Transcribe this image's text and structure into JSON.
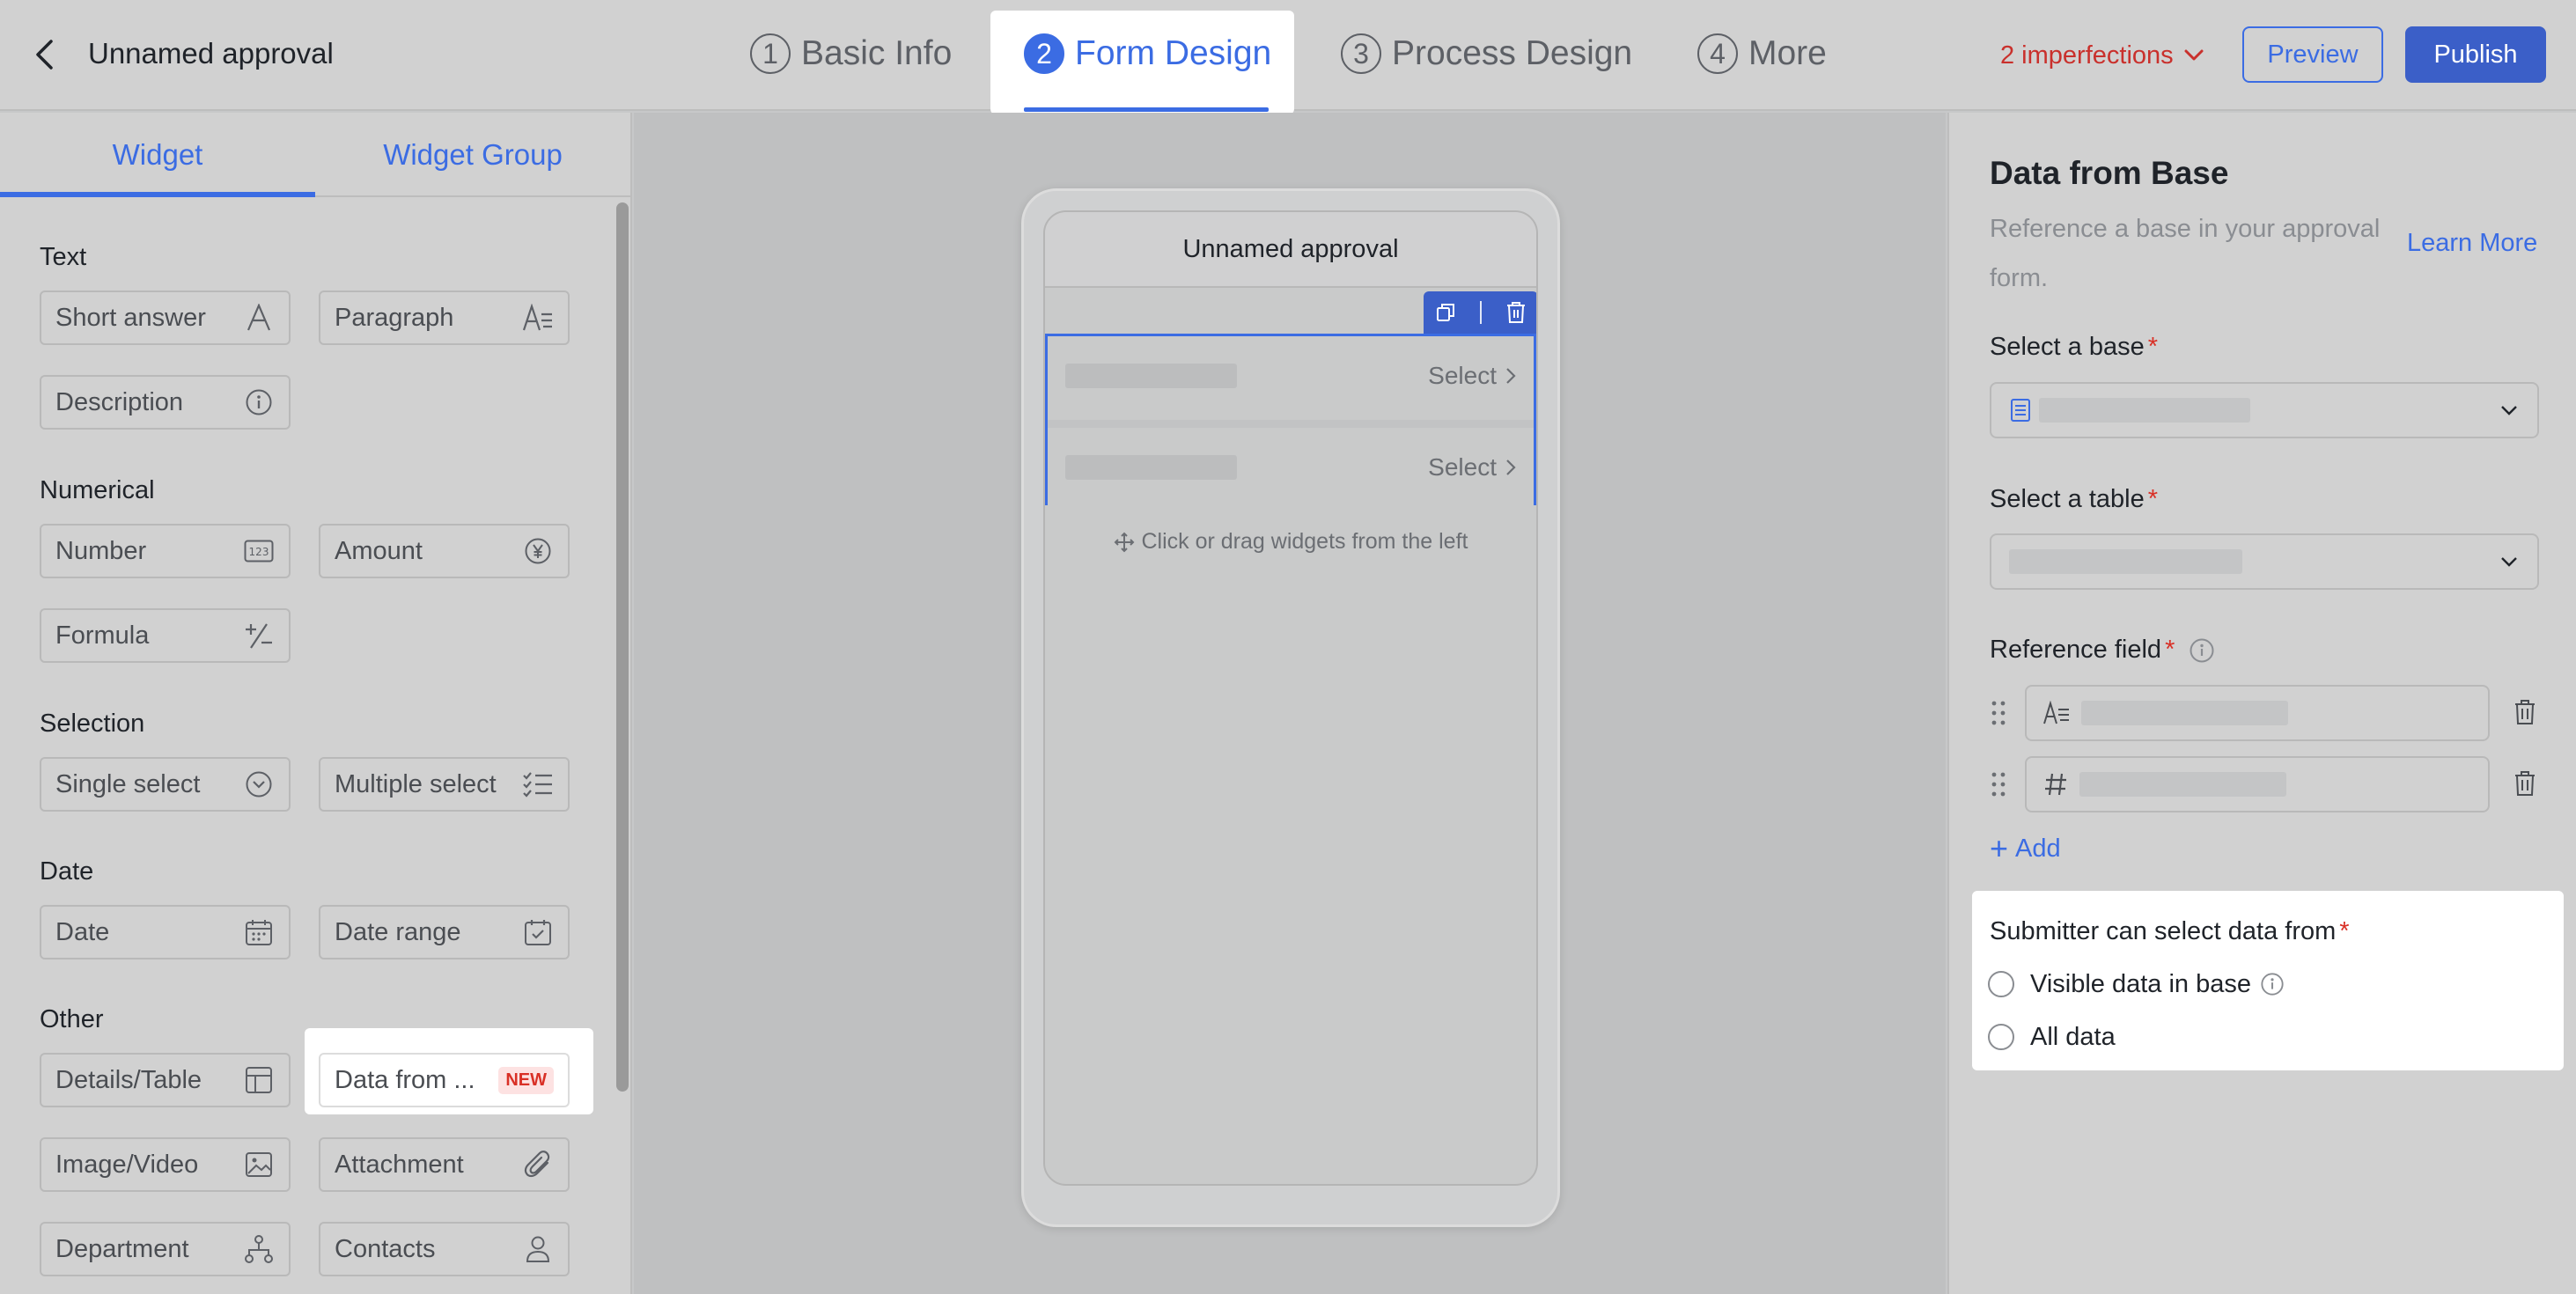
{
  "header": {
    "app_title": "Unnamed approval",
    "steps": [
      {
        "num": "1",
        "label": "Basic Info"
      },
      {
        "num": "2",
        "label": "Form Design"
      },
      {
        "num": "3",
        "label": "Process Design"
      },
      {
        "num": "4",
        "label": "More"
      }
    ],
    "active_step": "Form Design",
    "imperfections": "2 imperfections",
    "preview_label": "Preview",
    "publish_label": "Publish"
  },
  "left_panel": {
    "tabs": [
      "Widget",
      "Widget Group"
    ],
    "sections": {
      "text": "Text",
      "numerical": "Numerical",
      "selection": "Selection",
      "date": "Date",
      "other": "Other"
    },
    "widgets": {
      "short_answer": "Short answer",
      "paragraph": "Paragraph",
      "description": "Description",
      "number": "Number",
      "amount": "Amount",
      "formula": "Formula",
      "single_select": "Single select",
      "multiple_select": "Multiple select",
      "date": "Date",
      "date_range": "Date range",
      "details_table": "Details/Table",
      "data_from": "Data from ...",
      "image_video": "Image/Video",
      "attachment": "Attachment",
      "department": "Department",
      "contacts": "Contacts"
    },
    "new_badge": "NEW"
  },
  "canvas": {
    "phone_title": "Unnamed approval",
    "rows": [
      {
        "action": "Select"
      },
      {
        "action": "Select"
      }
    ],
    "drop_hint": "Click or drag widgets from the left"
  },
  "right_panel": {
    "title": "Data from Base",
    "description": "Reference a base in your approval form.",
    "learn_more": "Learn More",
    "select_base_label": "Select a base",
    "select_table_label": "Select a table",
    "reference_field_label": "Reference field",
    "add_label": "Add",
    "submitter_label": "Submitter can select data from",
    "options": [
      "Visible data in base",
      "All data"
    ]
  },
  "colors": {
    "accent": "#3b6ce3",
    "publish_bg": "#3b5fc8",
    "error": "#c9302c",
    "new_badge_bg": "#fde2e2",
    "new_badge_text": "#d93026"
  }
}
